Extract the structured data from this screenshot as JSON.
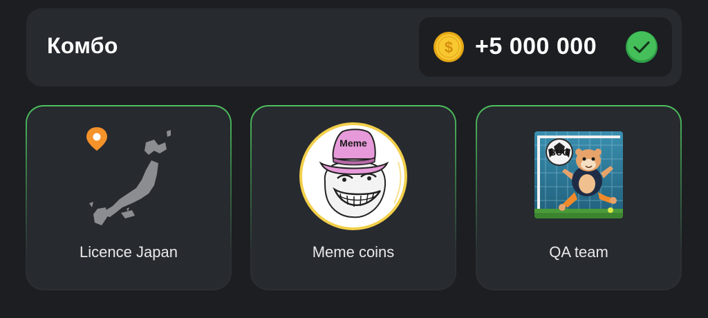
{
  "combo": {
    "title": "Комбо",
    "reward": "+5 000 000",
    "coin_icon": "dollar-coin-icon",
    "status_icon": "check-circle-icon",
    "colors": {
      "coin": "#f6c12a",
      "check": "#38b24f",
      "card_border": "#4fc35f"
    }
  },
  "cards": [
    {
      "label": "Licence Japan",
      "icon": "japan-map-icon"
    },
    {
      "label": "Meme coins",
      "icon": "meme-troll-icon",
      "badge_text": "Meme"
    },
    {
      "label": "QA team",
      "icon": "qa-hamster-icon",
      "badge_text": "BUG"
    }
  ]
}
